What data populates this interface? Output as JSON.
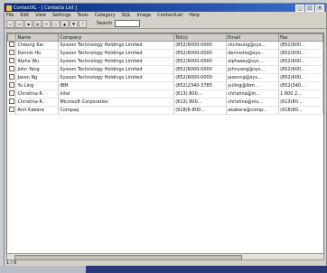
{
  "window": {
    "title": "ContactXL - [ Contacts List ]"
  },
  "menu": [
    "File",
    "Edit",
    "View",
    "Settings",
    "Tools",
    "Category",
    "SQL",
    "Image",
    "ContactList",
    "Help"
  ],
  "toolbar": {
    "search_label": "Search",
    "search_value": ""
  },
  "columns": [
    "Name",
    "Company",
    "Tel(o)",
    "Email",
    "Fax"
  ],
  "rows": [
    [
      "Cheung Kai",
      "Sysoon Technology Holdings Limited",
      "(852)6000-0000",
      "ckcheung@sys...",
      "(852)600..."
    ],
    [
      "Dennis Ho",
      "Sysoon Technology Holdings Limited",
      "(852)6000-0000",
      "dennisho@sys...",
      "(852)600..."
    ],
    [
      "Alpha Wu",
      "Sysoon Technology Holdings Limited",
      "(852)6000-0000",
      "alphawu@sys...",
      "(852)600..."
    ],
    [
      "John Yang",
      "Sysoon Technology Holdings Limited",
      "(852)6000-0000",
      "johnyang@sys...",
      "(852)600..."
    ],
    [
      "Jason Ng",
      "Sysoon Technology Holdings Limited",
      "(852)6000-0000",
      "jasonng@sys...",
      "(852)600..."
    ],
    [
      "Yu Ling",
      "IBM",
      "(852)2340-3785",
      "yuling@ibm...",
      "(852)340..."
    ],
    [
      "Christina R.",
      "Intel",
      "(613) 800...",
      "christina@in...",
      "1 800 2..."
    ],
    [
      "Christina R.",
      "Microsoft Corporation",
      "(613) 800...",
      "christina@ms...",
      "(613)80..."
    ],
    [
      "Anit Kabera",
      "Compaq",
      "(918)6-800...",
      "akabera@comp...",
      "(918)80..."
    ]
  ],
  "status": {
    "record": "1 / 9"
  }
}
